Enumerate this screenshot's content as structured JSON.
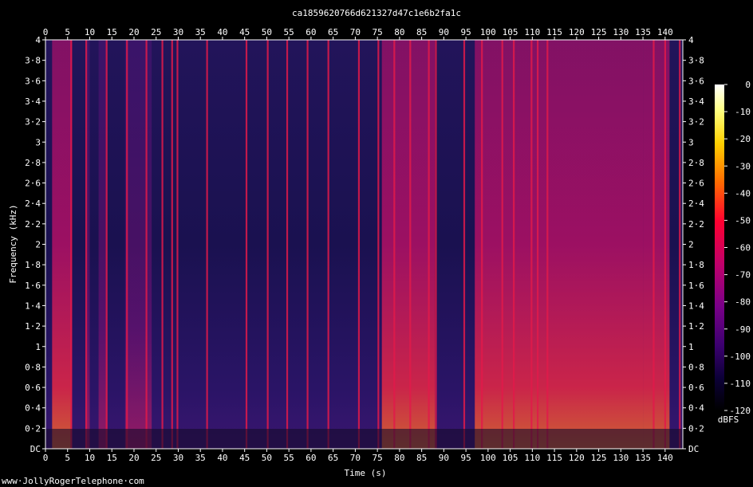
{
  "chart_data": {
    "type": "heatmap",
    "title": "ca1859620766d621327d47c1e6b2fa1c",
    "xlabel": "Time (s)",
    "ylabel": "Frequency (kHz)",
    "xlim": [
      0,
      144
    ],
    "ylim": [
      0,
      4
    ],
    "x_ticks": [
      "0",
      "5",
      "10",
      "15",
      "20",
      "25",
      "30",
      "35",
      "40",
      "45",
      "50",
      "55",
      "60",
      "65",
      "70",
      "75",
      "80",
      "85",
      "90",
      "95",
      "100",
      "105",
      "110",
      "115",
      "120",
      "125",
      "130",
      "135",
      "140"
    ],
    "y_ticks": [
      "DC",
      "0·2",
      "0·4",
      "0·6",
      "0·8",
      "1",
      "1·2",
      "1·4",
      "1·6",
      "1·8",
      "2",
      "2·2",
      "2·4",
      "2·6",
      "2·8",
      "3",
      "3·2",
      "3·4",
      "3·6",
      "3·8",
      "4"
    ],
    "colorbar": {
      "label": "dBFS",
      "ticks": [
        "0",
        "-10",
        "-20",
        "-30",
        "-40",
        "-50",
        "-60",
        "-70",
        "-80",
        "-90",
        "-100",
        "-110",
        "-120"
      ],
      "range": [
        -120,
        0
      ]
    },
    "vertical_lines_s": [
      5.8,
      9.2,
      13.8,
      18.4,
      22.8,
      26.4,
      28.6,
      29.8,
      36.5,
      45.4,
      50.2,
      54.6,
      59.2,
      63.9,
      70.8,
      75.2,
      78.8,
      82.4,
      86.6,
      88.2,
      94.6,
      98.6,
      103.2,
      105.8,
      109.8,
      111.2,
      113.4,
      137.4,
      140.0,
      143.3
    ],
    "energy_regions": [
      {
        "start_s": 1.5,
        "end_s": 6,
        "level": "high"
      },
      {
        "start_s": 9,
        "end_s": 10,
        "level": "medium"
      },
      {
        "start_s": 12,
        "end_s": 14,
        "level": "medium"
      },
      {
        "start_s": 18,
        "end_s": 24,
        "level": "medium"
      },
      {
        "start_s": 76,
        "end_s": 88,
        "level": "high"
      },
      {
        "start_s": 97,
        "end_s": 135,
        "level": "high"
      },
      {
        "start_s": 135,
        "end_s": 141,
        "level": "high"
      }
    ]
  },
  "footer_text": "www·JollyRogerTelephone·com"
}
